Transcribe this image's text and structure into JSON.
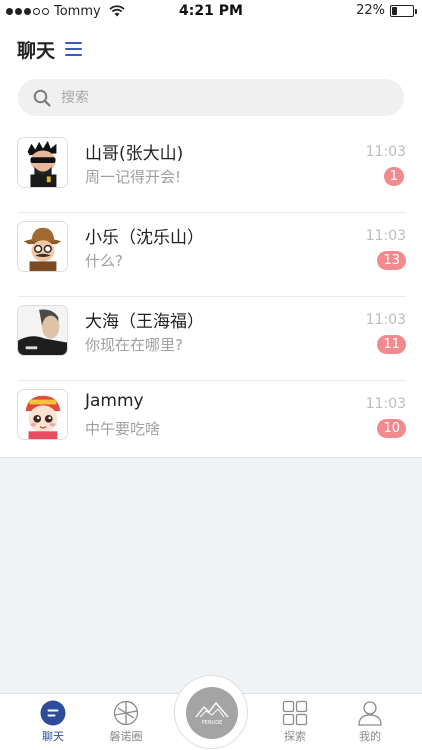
{
  "status_bar": {
    "carrier": "Tommy",
    "time": "4:21 PM",
    "battery": "22%",
    "battery_level": 0.22
  },
  "header": {
    "title": "聊天",
    "menu_icon": "menu-icon"
  },
  "search": {
    "placeholder": "搜索",
    "icon": "search-icon"
  },
  "chats": [
    {
      "name": "山哥(张大山)",
      "message": "周一记得开会!",
      "time": "11:03",
      "unread": "1"
    },
    {
      "name": "小乐（沈乐山）",
      "message": "什么?",
      "time": "11:03",
      "unread": "13"
    },
    {
      "name": "大海（王海福）",
      "message": "你现在在哪里?",
      "time": "11:03",
      "unread": "11"
    },
    {
      "name": "Jammy",
      "message": "中午要吃啥",
      "time": "11:03",
      "unread": "10"
    }
  ],
  "tabbar": {
    "tabs": [
      {
        "label": "聊天",
        "icon": "chat-icon",
        "active": true
      },
      {
        "label": "磐诺圈",
        "icon": "circle-icon",
        "active": false
      },
      {
        "label": "探索",
        "icon": "grid-icon",
        "active": false
      },
      {
        "label": "我的",
        "icon": "user-icon",
        "active": false
      }
    ],
    "center_logo_text": "PENUOE"
  },
  "colors": {
    "accent": "#2d4d9c",
    "badge": "#f08a8f",
    "background": "#eff3f6"
  }
}
